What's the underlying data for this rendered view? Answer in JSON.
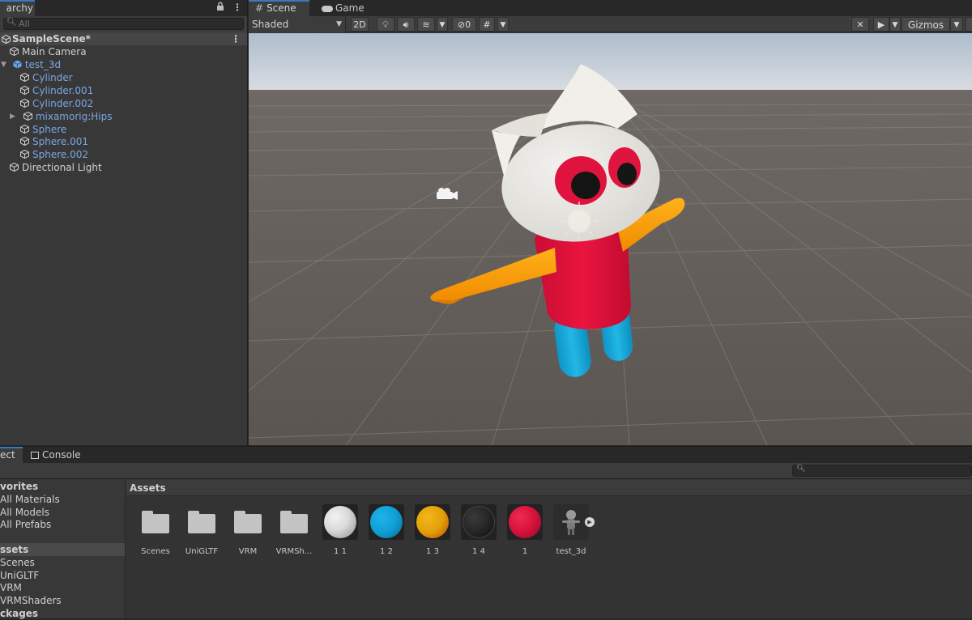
{
  "hierarchy": {
    "tab_label": "Hierarchy",
    "tab_visible": "archy",
    "search_placeholder": "All",
    "scene_name": "SampleScene*",
    "items": [
      {
        "label": "Main Camera"
      },
      {
        "label": "test_3d"
      },
      {
        "label": "Cylinder"
      },
      {
        "label": "Cylinder.001"
      },
      {
        "label": "Cylinder.002"
      },
      {
        "label": "mixamorig:Hips"
      },
      {
        "label": "Sphere"
      },
      {
        "label": "Sphere.001"
      },
      {
        "label": "Sphere.002"
      },
      {
        "label": "Directional Light"
      }
    ]
  },
  "scene": {
    "tabs": [
      {
        "label": "Scene"
      },
      {
        "label": "Game"
      }
    ],
    "shading_mode": "Shaded",
    "toggle_2d": "2D",
    "hidden_count": "0",
    "gizmos_label": "Gizmos"
  },
  "project": {
    "tabs": [
      {
        "label": "ect"
      },
      {
        "label": "Console"
      }
    ],
    "left": {
      "favorites_head": "vorites",
      "favorites": [
        "All Materials",
        "All Models",
        "All Prefabs"
      ],
      "assets_head": "ssets",
      "assets": [
        "Scenes",
        "UniGLTF",
        "VRM",
        "VRMShaders"
      ],
      "packages_head": "ckages"
    },
    "path": "Assets",
    "grid": [
      {
        "label": "Scenes",
        "kind": "folder"
      },
      {
        "label": "UniGLTF",
        "kind": "folder"
      },
      {
        "label": "VRM",
        "kind": "folder"
      },
      {
        "label": "VRMSh...",
        "kind": "folder"
      },
      {
        "label": "1 1",
        "kind": "material",
        "color": "#d9d9d9"
      },
      {
        "label": "1 2",
        "kind": "material",
        "color": "#0f9fd6"
      },
      {
        "label": "1 3",
        "kind": "material",
        "color": "#e3a107"
      },
      {
        "label": "1 4",
        "kind": "material",
        "color": "#262626"
      },
      {
        "label": "1",
        "kind": "material",
        "color": "#d6113a"
      },
      {
        "label": "test_3d",
        "kind": "model"
      }
    ]
  },
  "colors": {
    "accent": "#3a79bb",
    "blue_text": "#7aa6e4",
    "character_body": "#e0123a",
    "character_arms": "#ff9a00",
    "character_legs": "#1aa9d9",
    "character_head": "#e9e7e2"
  }
}
